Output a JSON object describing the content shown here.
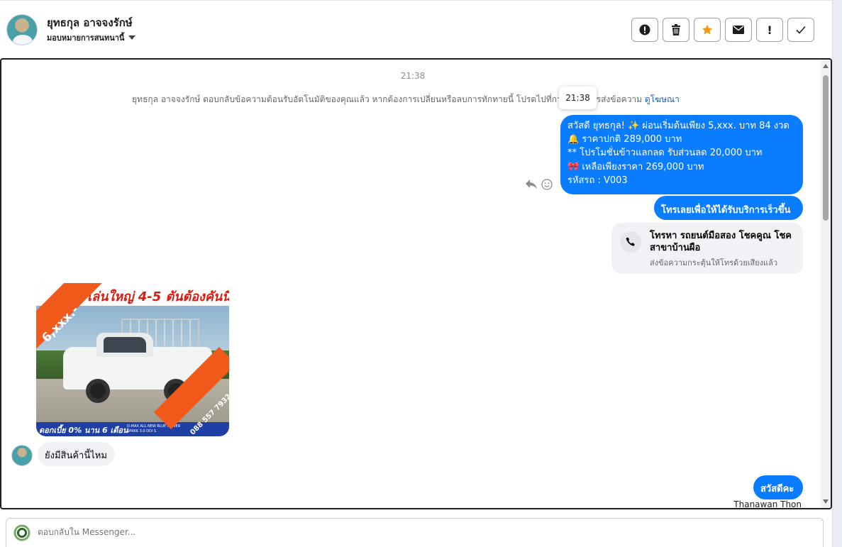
{
  "header": {
    "contact_name": "ยุทธกุล อาจจงรักษ์",
    "assign_label": "มอบหมายการสนทนานี้",
    "actions": [
      {
        "name": "spam-icon",
        "glyph": "●!"
      },
      {
        "name": "trash-icon",
        "glyph": "🗑"
      },
      {
        "name": "star-icon",
        "glyph": "★"
      },
      {
        "name": "envelope-icon",
        "glyph": "✉"
      },
      {
        "name": "exclamation-icon",
        "glyph": "!"
      },
      {
        "name": "checkmark-icon",
        "glyph": "✓"
      }
    ]
  },
  "conversation": {
    "time_label": "21:38",
    "system_message": "ยุทธกุล อาจจงรักษ์ ตอบกลับข้อความต้อนรับอัตโนมัติของคุณแล้ว หากต้องการเปลี่ยนหรือลบการทักทายนี้ โปรดไปที่การตั้งค่าการส่งข้อความ",
    "system_link": "ดูโฆษณา",
    "tooltip_time": "21:38",
    "promo_lines": [
      "สวัสดี ยุทธกุล! ✨  ผ่อนเริ่มต้นเพียง 5,xxx. บาท 84 งวด",
      "🔔 ราคาปกติ 289,000 บาท",
      "** โปรโมชั่นข้าวแลกลด รับส่วนลด 20,000 บาท",
      "🎀  เหลือเพียงราคา 269,000 บาท",
      " รหัสรถ : V003"
    ],
    "call_button_label": "โทรเลยเพื่อให้ได้รับบริการเร็วขึ้น",
    "call_card": {
      "title": "โทรหา รถยนต์มือสอง โชคคูณ โชค สาขาบ้านผือ",
      "subtitle": "ส่งข้อความกระตุ้นให้โทรด้วยเสียงแล้ว"
    },
    "ad": {
      "headline": "เล่นใหญ่ 4-5 ตันต้องคันนี้",
      "corner_small": "ผ่อนเริ่ม",
      "corner_price": "6,xxx.-",
      "bottom_text": "ดอกเบี้ย 0% นาน 6 เดือน",
      "bottom_small": "D-MAX ALL NEW BLUE POWER SPARK 3.0 DDI S",
      "stripe_text": "088 557 7932"
    },
    "incoming_message": "ยังมีสินค้านี้ไหม",
    "reply_message": "สวัสดีคะ",
    "sender_name": "Thanawan Thon"
  },
  "composer": {
    "placeholder": "ตอบกลับใน Messenger..."
  },
  "colors": {
    "accent": "#0a7cff",
    "star": "#f39c12"
  }
}
